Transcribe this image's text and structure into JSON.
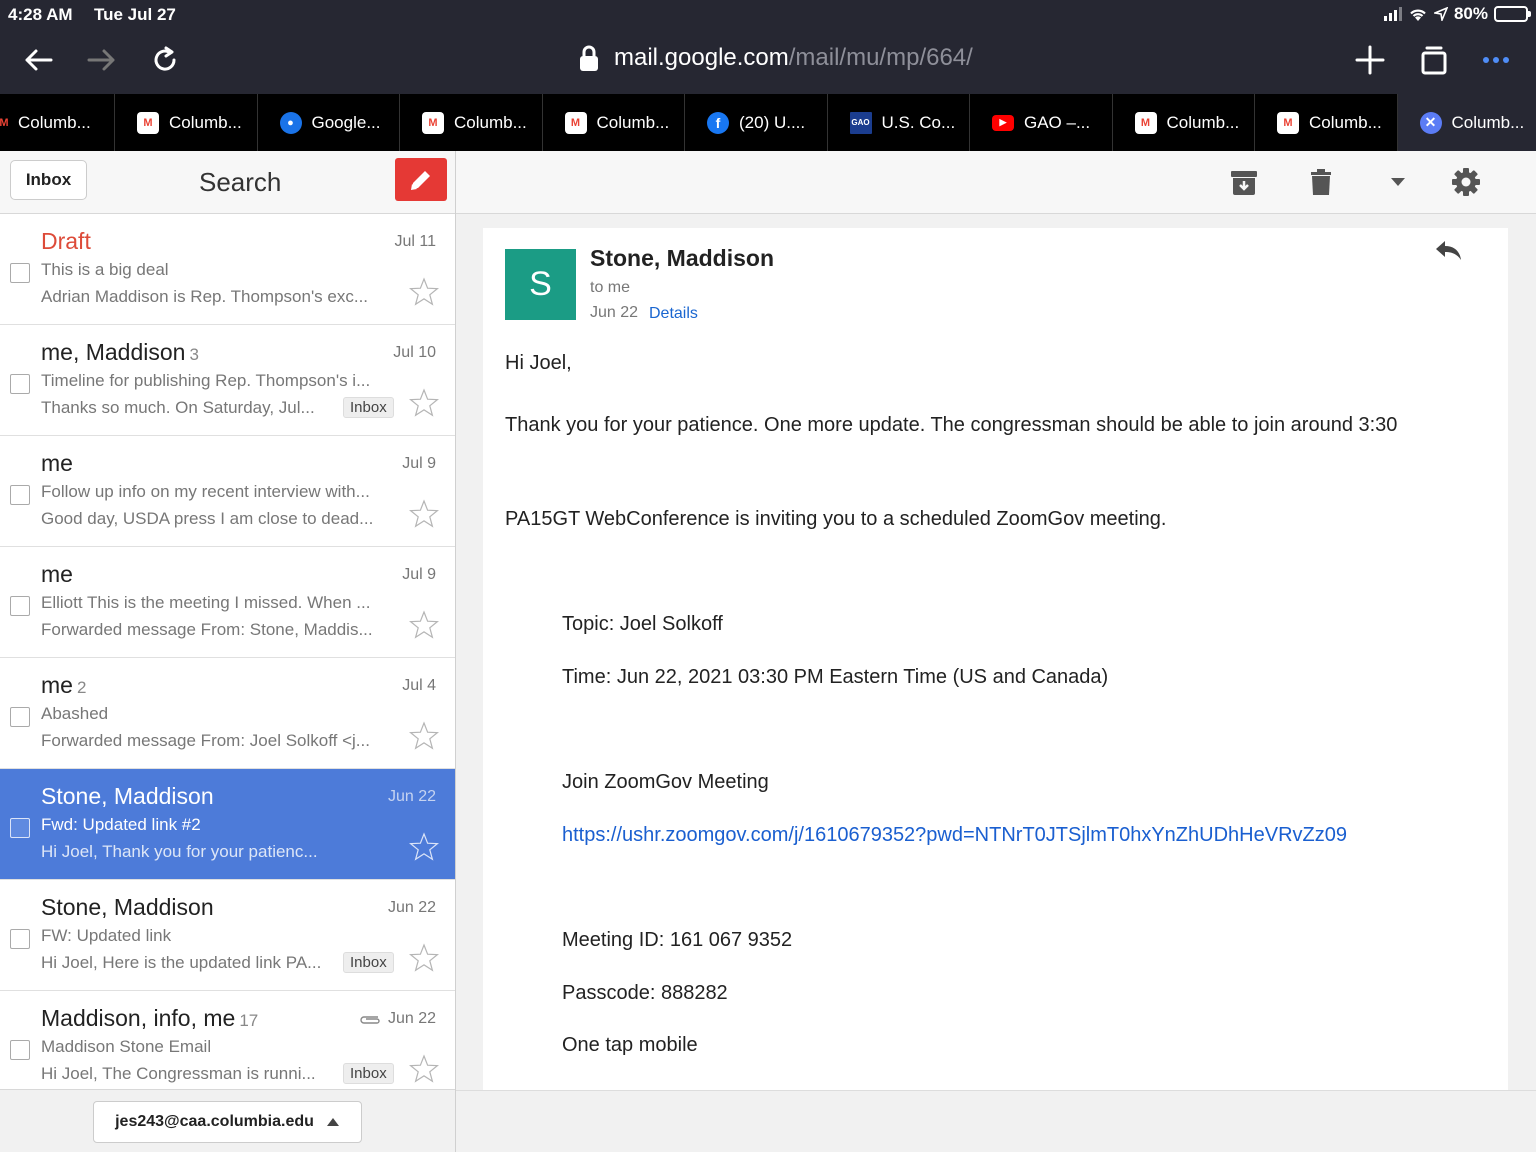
{
  "status": {
    "time": "4:28 AM",
    "date": "Tue Jul 27",
    "battery": "80%"
  },
  "browser": {
    "url_host": "mail.google.com",
    "url_path": "/mail/mu/mp/664/"
  },
  "tabs": [
    {
      "title": "Columb...",
      "icon": "gmail-icon"
    },
    {
      "title": "Columb...",
      "icon": "gmail-icon"
    },
    {
      "title": "Google...",
      "icon": "google-account-icon"
    },
    {
      "title": "Columb...",
      "icon": "gmail-icon"
    },
    {
      "title": "Columb...",
      "icon": "gmail-icon"
    },
    {
      "title": "(20) U....",
      "icon": "facebook-icon"
    },
    {
      "title": "U.S. Co...",
      "icon": "gao-icon"
    },
    {
      "title": "GAO –...",
      "icon": "youtube-icon"
    },
    {
      "title": "Columb...",
      "icon": "gmail-icon"
    },
    {
      "title": "Columb...",
      "icon": "gmail-icon"
    },
    {
      "title": "Columb...",
      "icon": "close-tab-icon"
    }
  ],
  "left": {
    "back_label": "Inbox",
    "search_label": "Search",
    "account": "jes243@caa.columbia.edu"
  },
  "messages": [
    {
      "from": "Draft",
      "count": "",
      "date": "Jul 11",
      "subject": "This is a big deal",
      "snippet": "Adrian Maddison is Rep. Thompson's exc...",
      "label": ""
    },
    {
      "from": "me, Maddison",
      "count": "3",
      "date": "Jul 10",
      "subject": "Timeline for publishing Rep. Thompson's i...",
      "snippet": "Thanks so much. On Saturday, Jul...",
      "label": "Inbox"
    },
    {
      "from": "me",
      "count": "",
      "date": "Jul 9",
      "subject": "Follow up info on my recent interview with...",
      "snippet": "Good day, USDA press I am close to dead...",
      "label": ""
    },
    {
      "from": "me",
      "count": "",
      "date": "Jul 9",
      "subject": "Elliott This is the meeting I missed. When ...",
      "snippet": "Forwarded message From: Stone, Maddis...",
      "label": ""
    },
    {
      "from": "me",
      "count": "2",
      "date": "Jul 4",
      "subject": "Abashed",
      "snippet": "Forwarded message From: Joel Solkoff <j...",
      "label": ""
    },
    {
      "from": "Stone, Maddison",
      "count": "",
      "date": "Jun 22",
      "subject": "Fwd: Updated link #2",
      "snippet": "Hi Joel, Thank you for your patienc...",
      "label": ""
    },
    {
      "from": "Stone, Maddison",
      "count": "",
      "date": "Jun 22",
      "subject": "FW: Updated link",
      "snippet": "Hi Joel, Here is the updated link PA...",
      "label": "Inbox"
    },
    {
      "from": "Maddison, info, me",
      "count": "17",
      "date": "Jun 22",
      "subject": "Maddison Stone Email",
      "snippet": "Hi Joel, The Congressman is runni...",
      "label": "Inbox"
    }
  ],
  "email": {
    "avatar_letter": "S",
    "sender": "Stone, Maddison",
    "to": "to me",
    "date": "Jun 22",
    "details": "Details",
    "greeting": "Hi Joel,",
    "line1": "Thank you for your patience. One more update. The congressman should be able to join around 3:30",
    "line2": "PA15GT WebConference is inviting you to a scheduled ZoomGov meeting.",
    "topic": "Topic: Joel Solkoff",
    "time": "Time: Jun 22, 2021 03:30 PM Eastern Time (US and Canada)",
    "join": "Join ZoomGov Meeting",
    "link": "https://ushr.zoomgov.com/j/1610679352?pwd=NTNrT0JTSjlmT0hxYnZhUDhHeVRvZz09",
    "meeting_id": "Meeting ID: 161 067 9352",
    "passcode": "Passcode: 888282",
    "one_tap": "One tap mobile"
  },
  "colors": {
    "selected": "#4d7bd9",
    "compose": "#e53935",
    "avatar": "#1b9c85",
    "link": "#1a5fd0",
    "draft": "#dd4b39"
  }
}
